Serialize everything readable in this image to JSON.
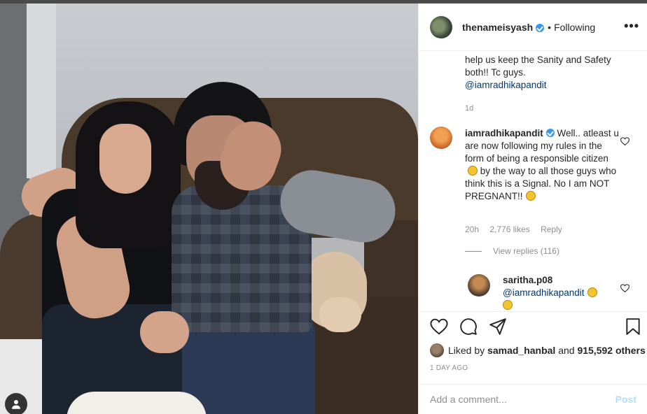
{
  "post": {
    "username": "thenameisyash",
    "separator": "•",
    "follow_status": "Following",
    "more_label": "•••"
  },
  "caption": {
    "text": "help us keep the Sanity and Safety both!! Tc guys.",
    "mention": "@iamradhikapandit",
    "time": "1d"
  },
  "comment1": {
    "username": "iamradhikapandit",
    "text": "Well.. atleast u are now following my rules in the form of being a responsible citizen",
    "text2": "by the way to all those guys who think this is a Signal. No I am NOT PREGNANT!!",
    "time": "20h",
    "likes": "2,776 likes",
    "reply": "Reply",
    "view_replies": "View replies (116)"
  },
  "reply1": {
    "username": "saritha.p08",
    "mention": "@iamradhikapandit"
  },
  "likes": {
    "prefix": "Liked by",
    "user": "samad_hanbal",
    "and": "and",
    "others": "915,592 others"
  },
  "age": "1 DAY AGO",
  "comment_box": {
    "placeholder": "Add a comment...",
    "post_label": "Post"
  },
  "colors": {
    "link": "#00376b",
    "verified": "#3897f0",
    "muted": "#8e8e8e",
    "post_disabled": "#b2dffc"
  }
}
